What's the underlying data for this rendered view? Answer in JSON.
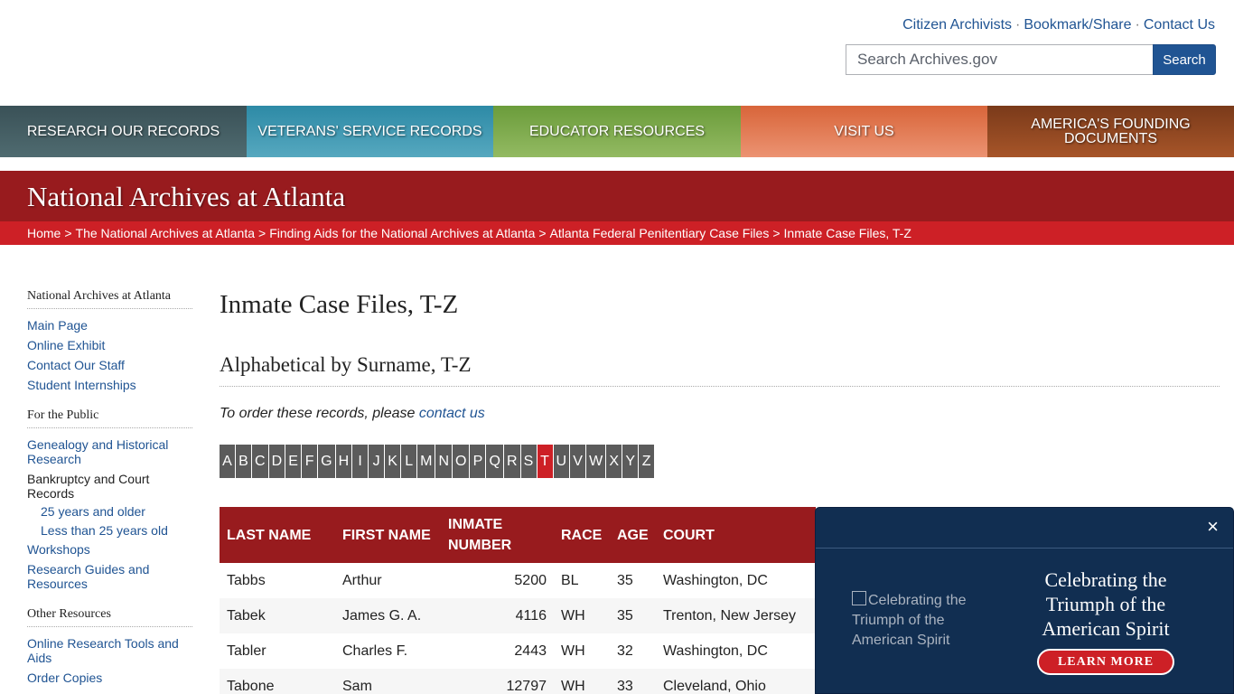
{
  "utility": {
    "links": [
      "Citizen Archivists",
      "Bookmark/Share",
      "Contact Us"
    ],
    "separator": "·"
  },
  "search": {
    "placeholder": "Search Archives.gov",
    "button": "Search"
  },
  "nav": [
    "Research Our Records",
    "Veterans' Service Records",
    "Educator Resources",
    "Visit Us",
    "America's Founding Documents"
  ],
  "banner": {
    "title": "National Archives at Atlanta"
  },
  "breadcrumb": [
    "Home",
    "The National Archives at Atlanta",
    "Finding Aids for the National Archives at Atlanta",
    "Atlanta Federal Penitentiary Case Files",
    "Inmate Case Files, T-Z"
  ],
  "sidebar": {
    "group1": {
      "heading": "National Archives at Atlanta",
      "links": [
        "Main Page",
        "Online Exhibit",
        "Contact Our Staff",
        "Student Internships"
      ]
    },
    "group2": {
      "heading": "For the Public",
      "genealogy": "Genealogy and Historical Research",
      "bankruptcy": "Bankruptcy and Court Records",
      "sub": [
        "25 years and older",
        "Less than 25 years old"
      ],
      "workshops": "Workshops",
      "guides": "Research Guides and Resources"
    },
    "group3": {
      "heading": "Other Resources",
      "links": [
        "Online Research Tools and Aids",
        "Order Copies"
      ]
    }
  },
  "main": {
    "title": "Inmate Case Files, T-Z",
    "subtitle": "Alphabetical by Surname, T-Z",
    "order_text": "To order these records, please",
    "order_link": "contact us",
    "letters": [
      "A",
      "B",
      "C",
      "D",
      "E",
      "F",
      "G",
      "H",
      "I",
      "J",
      "K",
      "L",
      "M",
      "N",
      "O",
      "P",
      "Q",
      "R",
      "S",
      "T",
      "U",
      "V",
      "W",
      "X",
      "Y",
      "Z"
    ],
    "active_letter": "T"
  },
  "table": {
    "headers": [
      "LAST NAME",
      "FIRST NAME",
      "INMATE NUMBER",
      "RACE",
      "AGE",
      "COURT"
    ],
    "rows": [
      [
        "Tabbs",
        "Arthur",
        "5200",
        "BL",
        "35",
        "Washington, DC"
      ],
      [
        "Tabek",
        "James G. A.",
        "4116",
        "WH",
        "35",
        "Trenton, New Jersey"
      ],
      [
        "Tabler",
        "Charles F.",
        "2443",
        "WH",
        "32",
        "Washington, DC"
      ],
      [
        "Tabone",
        "Sam",
        "12797",
        "WH",
        "33",
        "Cleveland, Ohio"
      ]
    ]
  },
  "popup": {
    "close": "×",
    "image_alt": "Celebrating the Triumph of the American Spirit",
    "title": "Celebrating the Triumph of the American Spirit",
    "button": "LEARN MORE"
  }
}
